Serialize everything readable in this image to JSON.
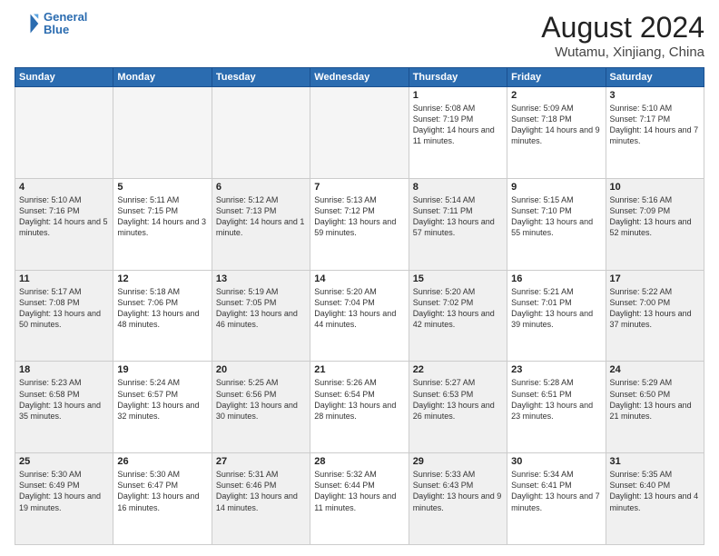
{
  "logo": {
    "line1": "General",
    "line2": "Blue"
  },
  "title": {
    "month_year": "August 2024",
    "location": "Wutamu, Xinjiang, China"
  },
  "weekdays": [
    "Sunday",
    "Monday",
    "Tuesday",
    "Wednesday",
    "Thursday",
    "Friday",
    "Saturday"
  ],
  "weeks": [
    [
      {
        "day": "",
        "info": "",
        "empty": true
      },
      {
        "day": "",
        "info": "",
        "empty": true
      },
      {
        "day": "",
        "info": "",
        "empty": true
      },
      {
        "day": "",
        "info": "",
        "empty": true
      },
      {
        "day": "1",
        "info": "Sunrise: 5:08 AM\nSunset: 7:19 PM\nDaylight: 14 hours\nand 11 minutes."
      },
      {
        "day": "2",
        "info": "Sunrise: 5:09 AM\nSunset: 7:18 PM\nDaylight: 14 hours\nand 9 minutes."
      },
      {
        "day": "3",
        "info": "Sunrise: 5:10 AM\nSunset: 7:17 PM\nDaylight: 14 hours\nand 7 minutes."
      }
    ],
    [
      {
        "day": "4",
        "info": "Sunrise: 5:10 AM\nSunset: 7:16 PM\nDaylight: 14 hours\nand 5 minutes.",
        "shaded": true
      },
      {
        "day": "5",
        "info": "Sunrise: 5:11 AM\nSunset: 7:15 PM\nDaylight: 14 hours\nand 3 minutes."
      },
      {
        "day": "6",
        "info": "Sunrise: 5:12 AM\nSunset: 7:13 PM\nDaylight: 14 hours\nand 1 minute.",
        "shaded": true
      },
      {
        "day": "7",
        "info": "Sunrise: 5:13 AM\nSunset: 7:12 PM\nDaylight: 13 hours\nand 59 minutes."
      },
      {
        "day": "8",
        "info": "Sunrise: 5:14 AM\nSunset: 7:11 PM\nDaylight: 13 hours\nand 57 minutes.",
        "shaded": true
      },
      {
        "day": "9",
        "info": "Sunrise: 5:15 AM\nSunset: 7:10 PM\nDaylight: 13 hours\nand 55 minutes."
      },
      {
        "day": "10",
        "info": "Sunrise: 5:16 AM\nSunset: 7:09 PM\nDaylight: 13 hours\nand 52 minutes.",
        "shaded": true
      }
    ],
    [
      {
        "day": "11",
        "info": "Sunrise: 5:17 AM\nSunset: 7:08 PM\nDaylight: 13 hours\nand 50 minutes.",
        "shaded": true
      },
      {
        "day": "12",
        "info": "Sunrise: 5:18 AM\nSunset: 7:06 PM\nDaylight: 13 hours\nand 48 minutes."
      },
      {
        "day": "13",
        "info": "Sunrise: 5:19 AM\nSunset: 7:05 PM\nDaylight: 13 hours\nand 46 minutes.",
        "shaded": true
      },
      {
        "day": "14",
        "info": "Sunrise: 5:20 AM\nSunset: 7:04 PM\nDaylight: 13 hours\nand 44 minutes."
      },
      {
        "day": "15",
        "info": "Sunrise: 5:20 AM\nSunset: 7:02 PM\nDaylight: 13 hours\nand 42 minutes.",
        "shaded": true
      },
      {
        "day": "16",
        "info": "Sunrise: 5:21 AM\nSunset: 7:01 PM\nDaylight: 13 hours\nand 39 minutes."
      },
      {
        "day": "17",
        "info": "Sunrise: 5:22 AM\nSunset: 7:00 PM\nDaylight: 13 hours\nand 37 minutes.",
        "shaded": true
      }
    ],
    [
      {
        "day": "18",
        "info": "Sunrise: 5:23 AM\nSunset: 6:58 PM\nDaylight: 13 hours\nand 35 minutes.",
        "shaded": true
      },
      {
        "day": "19",
        "info": "Sunrise: 5:24 AM\nSunset: 6:57 PM\nDaylight: 13 hours\nand 32 minutes."
      },
      {
        "day": "20",
        "info": "Sunrise: 5:25 AM\nSunset: 6:56 PM\nDaylight: 13 hours\nand 30 minutes.",
        "shaded": true
      },
      {
        "day": "21",
        "info": "Sunrise: 5:26 AM\nSunset: 6:54 PM\nDaylight: 13 hours\nand 28 minutes."
      },
      {
        "day": "22",
        "info": "Sunrise: 5:27 AM\nSunset: 6:53 PM\nDaylight: 13 hours\nand 26 minutes.",
        "shaded": true
      },
      {
        "day": "23",
        "info": "Sunrise: 5:28 AM\nSunset: 6:51 PM\nDaylight: 13 hours\nand 23 minutes."
      },
      {
        "day": "24",
        "info": "Sunrise: 5:29 AM\nSunset: 6:50 PM\nDaylight: 13 hours\nand 21 minutes.",
        "shaded": true
      }
    ],
    [
      {
        "day": "25",
        "info": "Sunrise: 5:30 AM\nSunset: 6:49 PM\nDaylight: 13 hours\nand 19 minutes.",
        "shaded": true
      },
      {
        "day": "26",
        "info": "Sunrise: 5:30 AM\nSunset: 6:47 PM\nDaylight: 13 hours\nand 16 minutes."
      },
      {
        "day": "27",
        "info": "Sunrise: 5:31 AM\nSunset: 6:46 PM\nDaylight: 13 hours\nand 14 minutes.",
        "shaded": true
      },
      {
        "day": "28",
        "info": "Sunrise: 5:32 AM\nSunset: 6:44 PM\nDaylight: 13 hours\nand 11 minutes."
      },
      {
        "day": "29",
        "info": "Sunrise: 5:33 AM\nSunset: 6:43 PM\nDaylight: 13 hours\nand 9 minutes.",
        "shaded": true
      },
      {
        "day": "30",
        "info": "Sunrise: 5:34 AM\nSunset: 6:41 PM\nDaylight: 13 hours\nand 7 minutes."
      },
      {
        "day": "31",
        "info": "Sunrise: 5:35 AM\nSunset: 6:40 PM\nDaylight: 13 hours\nand 4 minutes.",
        "shaded": true
      }
    ]
  ]
}
